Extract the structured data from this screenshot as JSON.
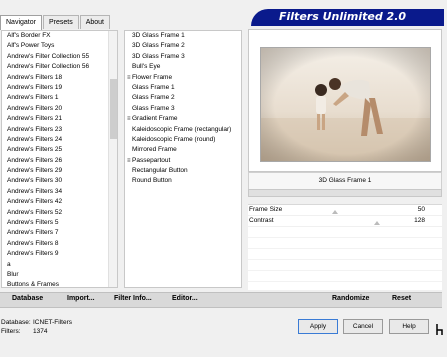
{
  "tabs": [
    "Navigator",
    "Presets",
    "About"
  ],
  "banner": {
    "title": "Filters Unlimited 2.0"
  },
  "filter_categories": [
    "Alf's Border FX",
    "Alf's Power Toys",
    "Andrew's Filter Collection 55",
    "Andrew's Filter Collection 56",
    "Andrew's Filters 18",
    "Andrew's Filters 19",
    "Andrew's Filters 1",
    "Andrew's Filters 20",
    "Andrew's Filters 21",
    "Andrew's Filters 23",
    "Andrew's Filters 24",
    "Andrew's Filters 25",
    "Andrew's Filters 26",
    "Andrew's Filters 29",
    "Andrew's Filters 30",
    "Andrew's Filters 34",
    "Andrew's Filters 42",
    "Andrew's Filters 52",
    "Andrew's Filters 5",
    "Andrew's Filters 7",
    "Andrew's Filters 8",
    "Andrew's Filters 9",
    "a",
    "Blur",
    "Buttons & Frames"
  ],
  "presets": [
    {
      "label": "3D Glass Frame 1",
      "kind": "child"
    },
    {
      "label": "3D Glass Frame 2",
      "kind": "child"
    },
    {
      "label": "3D Glass Frame 3",
      "kind": "child"
    },
    {
      "label": "Bull's Eye",
      "kind": "child"
    },
    {
      "label": "Flower Frame",
      "kind": "group"
    },
    {
      "label": "Glass Frame 1",
      "kind": "child"
    },
    {
      "label": "Glass Frame 2",
      "kind": "child"
    },
    {
      "label": "Glass Frame 3",
      "kind": "child"
    },
    {
      "label": "Gradient Frame",
      "kind": "group"
    },
    {
      "label": "Kaleidoscopic Frame (rectangular)",
      "kind": "child"
    },
    {
      "label": "Kaleidoscopic Frame (round)",
      "kind": "child"
    },
    {
      "label": "Mirrored Frame",
      "kind": "child"
    },
    {
      "label": "Passepartout",
      "kind": "group"
    },
    {
      "label": "Rectangular Button",
      "kind": "child"
    },
    {
      "label": "Round Button",
      "kind": "child"
    }
  ],
  "selected_filter": "3D Glass Frame 1",
  "params": [
    {
      "label": "Frame Size",
      "value": "50",
      "level": 0.2
    },
    {
      "label": "Contrast",
      "value": "128",
      "level": 0.5
    }
  ],
  "action_bar": {
    "database": "Database",
    "import": "Import...",
    "filter_info": "Filter Info...",
    "editor": "Editor...",
    "randomize": "Randomize",
    "reset": "Reset"
  },
  "footer": {
    "database_label": "Database:",
    "database_value": "ICNET-Filters",
    "filters_label": "Filters:",
    "filters_value": "1374"
  },
  "dialog_buttons": {
    "apply": "Apply",
    "cancel": "Cancel",
    "help": "Help"
  },
  "colors": {
    "banner": "#0a1a8c",
    "accent": "#3a7bd5"
  }
}
